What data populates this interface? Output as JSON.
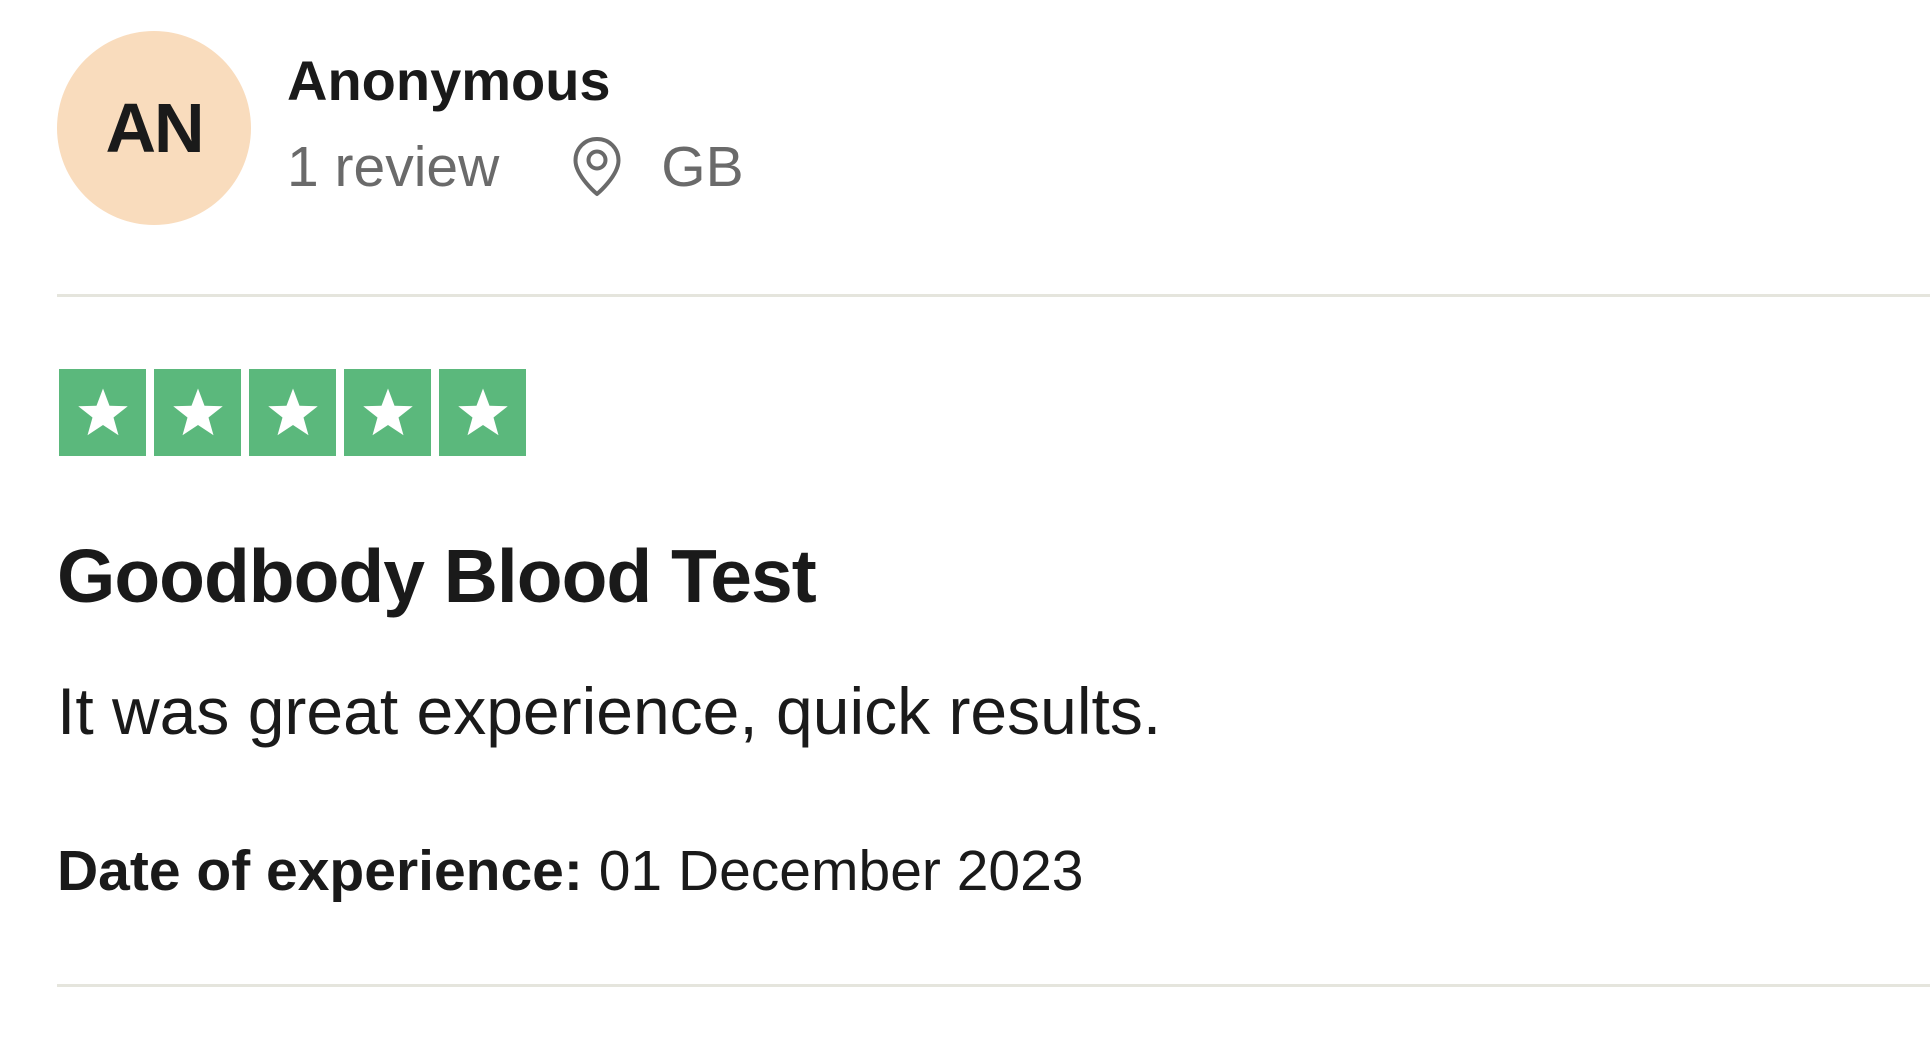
{
  "consumer": {
    "initials": "AN",
    "name": "Anonymous",
    "review_count": "1 review",
    "country": "GB",
    "avatar_color": "#f9dcbd",
    "location_icon": "map-pin-icon"
  },
  "review": {
    "rating": 5,
    "max_rating": 5,
    "star_color": "#5bb87c",
    "star_icon": "star-icon",
    "title": "Goodbody Blood Test",
    "body": "It was great experience, quick results.",
    "experience_label": "Date of experience:",
    "experience_date": "01 December 2023"
  }
}
